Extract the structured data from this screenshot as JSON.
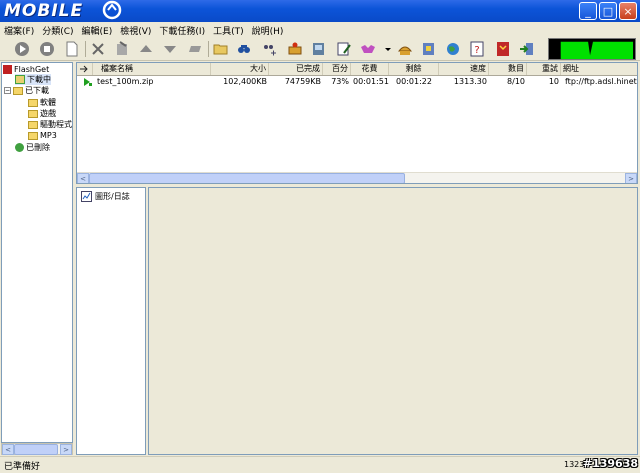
{
  "window": {
    "logo_text": "MOBILE"
  },
  "menu": [
    "檔案(F)",
    "分類(C)",
    "編輯(E)",
    "檢視(V)",
    "下載任務(I)",
    "工具(T)",
    "說明(H)"
  ],
  "tree": {
    "root": "FlashGet",
    "downloading": "下載中",
    "downloaded": "已下載",
    "sub": [
      "軟體",
      "遊戲",
      "驅動程式",
      "MP3"
    ],
    "deleted": "已刪除"
  },
  "columns": [
    "檔案名稱",
    "大小",
    "已完成",
    "百分",
    "花費",
    "剩餘",
    "速度",
    "數目",
    "重試",
    "網址"
  ],
  "rows": [
    {
      "name": "test_100m.zip",
      "size": "102,400KB",
      "done": "74759KB",
      "pct": "73%",
      "elapsed": "00:01:51",
      "remain": "00:01:22",
      "speed": "1313.30",
      "count": "8/10",
      "retry": "10",
      "url": "ftp://ftp.adsl.hinet.net"
    }
  ],
  "log": {
    "label": "圖形/日誌"
  },
  "status": {
    "text": "已準備好",
    "right": "1323",
    "watermark": "#139638"
  },
  "colors": {
    "title": "#0c54d8",
    "meter_bg": "#000000",
    "meter_fill": "#00e000"
  }
}
